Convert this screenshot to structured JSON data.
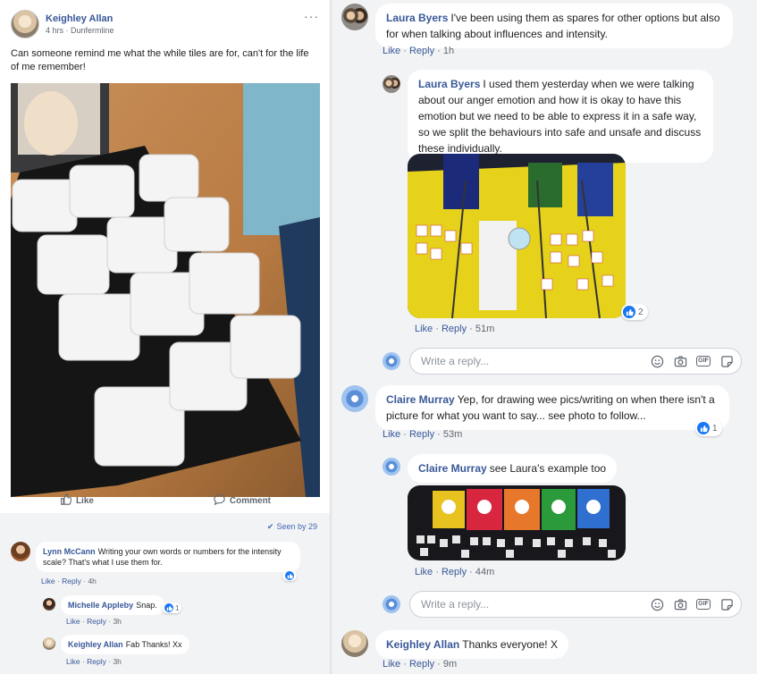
{
  "post": {
    "author": "Keighley Allan",
    "meta": "4 hrs · Dunfermline",
    "menu": "···",
    "text": "Can someone remind me what the while tiles are for, can't for the life of me remember!",
    "actions": {
      "like": "Like",
      "comment": "Comment"
    },
    "seen_by": "Seen by 29",
    "comments": [
      {
        "author": "Lynn McCann",
        "text": "Writing your own words or numbers for the intensity scale? That's what I use them for.",
        "like": "Like",
        "reply": "Reply",
        "time": "4h",
        "reactions": ""
      },
      {
        "author": "Michelle Appleby",
        "text": "Snap.",
        "like": "Like",
        "reply": "Reply",
        "time": "3h",
        "reactions": "1"
      },
      {
        "author": "Keighley Allan",
        "text": "Fab Thanks! Xx",
        "like": "Like",
        "reply": "Reply",
        "time": "3h",
        "reactions": ""
      }
    ]
  },
  "thread": {
    "comments": [
      {
        "author": "Laura Byers",
        "text": "I've been using them as spares for other options but also for when talking about influences and intensity.",
        "like": "Like",
        "reply": "Reply",
        "time": "1h"
      },
      {
        "author": "Laura Byers",
        "text": "I used them yesterday when we were talking about our anger emotion and how it is okay to have this emotion but we need to be able to express it in a safe way, so we split the behaviours into safe and unsafe and discuss these individually.",
        "like": "Like",
        "reply": "Reply",
        "time": "51m",
        "reactions": "2"
      },
      {
        "author": "Claire Murray",
        "text": "Yep, for drawing wee pics/writing on when there isn't a picture for what you want to say... see photo to follow...",
        "like": "Like",
        "reply": "Reply",
        "time": "53m",
        "reactions": "1"
      },
      {
        "author": "Claire Murray",
        "text": "see Laura's example too",
        "like": "Like",
        "reply": "Reply",
        "time": "44m"
      },
      {
        "author": "Keighley Allan",
        "text": "Thanks everyone! X",
        "like": "Like",
        "reply": "Reply",
        "time": "9m"
      }
    ],
    "reply_placeholder": "Write a reply...",
    "gif_label": "GIF"
  },
  "colors": {
    "link": "#385898",
    "bg": "#f2f3f5",
    "accent": "#1877f2"
  }
}
